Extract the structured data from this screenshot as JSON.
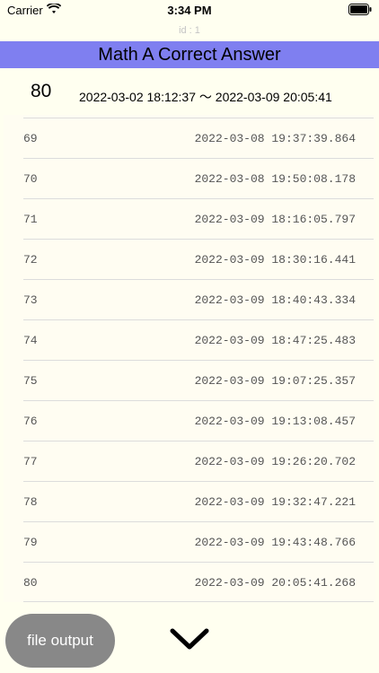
{
  "status": {
    "carrier": "Carrier",
    "time": "3:34 PM"
  },
  "record_id": "id : 1",
  "header": {
    "title": "Math A Correct Answer"
  },
  "summary": {
    "count": "80",
    "range": "2022-03-02 18:12:37 〜 2022-03-09 20:05:41"
  },
  "rows": [
    {
      "num": "69",
      "ts": "2022-03-08 19:37:39.864"
    },
    {
      "num": "70",
      "ts": "2022-03-08 19:50:08.178"
    },
    {
      "num": "71",
      "ts": "2022-03-09 18:16:05.797"
    },
    {
      "num": "72",
      "ts": "2022-03-09 18:30:16.441"
    },
    {
      "num": "73",
      "ts": "2022-03-09 18:40:43.334"
    },
    {
      "num": "74",
      "ts": "2022-03-09 18:47:25.483"
    },
    {
      "num": "75",
      "ts": "2022-03-09 19:07:25.357"
    },
    {
      "num": "76",
      "ts": "2022-03-09 19:13:08.457"
    },
    {
      "num": "77",
      "ts": "2022-03-09 19:26:20.702"
    },
    {
      "num": "78",
      "ts": "2022-03-09 19:32:47.221"
    },
    {
      "num": "79",
      "ts": "2022-03-09 19:43:48.766"
    },
    {
      "num": "80",
      "ts": "2022-03-09 20:05:41.268"
    }
  ],
  "footer": {
    "file_output_label": "file output",
    "scroll_icon": "chevron-down-icon"
  },
  "colors": {
    "header_bg": "#7f7ff0",
    "page_bg": "#fffff0",
    "button_bg": "#888888"
  }
}
